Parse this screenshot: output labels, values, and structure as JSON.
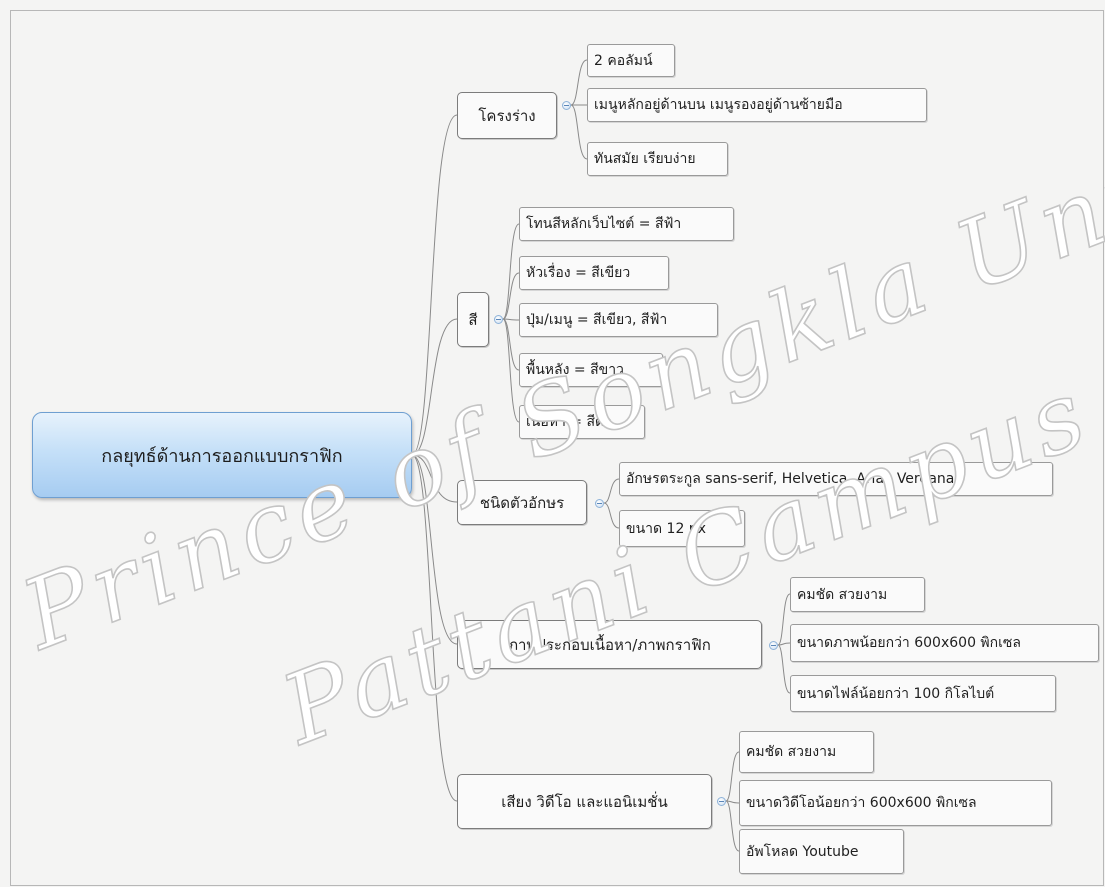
{
  "mindmap": {
    "central": "กลยุทธ์ด้านการออกแบบกราฟิก",
    "branches": [
      {
        "label": "โครงร่าง",
        "children": [
          "2 คอลัมน์",
          "เมนูหลักอยู่ด้านบน เมนูรองอยู่ด้านซ้ายมือ",
          "ทันสมัย เรียบง่าย"
        ]
      },
      {
        "label": "สี",
        "children": [
          "โทนสีหลักเว็บไซต์ = สีฟ้า",
          "หัวเรื่อง = สีเขียว",
          "ปุ่ม/เมนู = สีเขียว, สีฟ้า",
          "พื้นหลัง = สีขาว",
          "เนื้อหา = สีดำ"
        ]
      },
      {
        "label": "ชนิดตัวอักษร",
        "children": [
          "อักษรตระกูล sans-serif, Helvetica, Arial, Verdana",
          "ขนาด 12 px"
        ]
      },
      {
        "label": "ภาพประกอบเนื้อหา/ภาพกราฟิก",
        "children": [
          "คมชัด สวยงาม",
          "ขนาดภาพน้อยกว่า 600x600 พิกเซล",
          "ขนาดไฟล์น้อยกว่า 100 กิโลไบต์"
        ]
      },
      {
        "label": "เสียง วิดีโอ และแอนิเมชั่น",
        "children": [
          "คมชัด สวยงาม",
          "ขนาดวิดีโอน้อยกว่า 600x600 พิกเซล",
          "อัพโหลด Youtube"
        ]
      }
    ]
  },
  "watermark": [
    "Prince of Songkla University",
    "Pattani Campus"
  ],
  "colors": {
    "central_top": "#e7f2fc",
    "central_bottom": "#a6ccf1",
    "central_border": "#6f9fd1",
    "line": "#8a8a8a",
    "background": "#f4f4f3"
  }
}
